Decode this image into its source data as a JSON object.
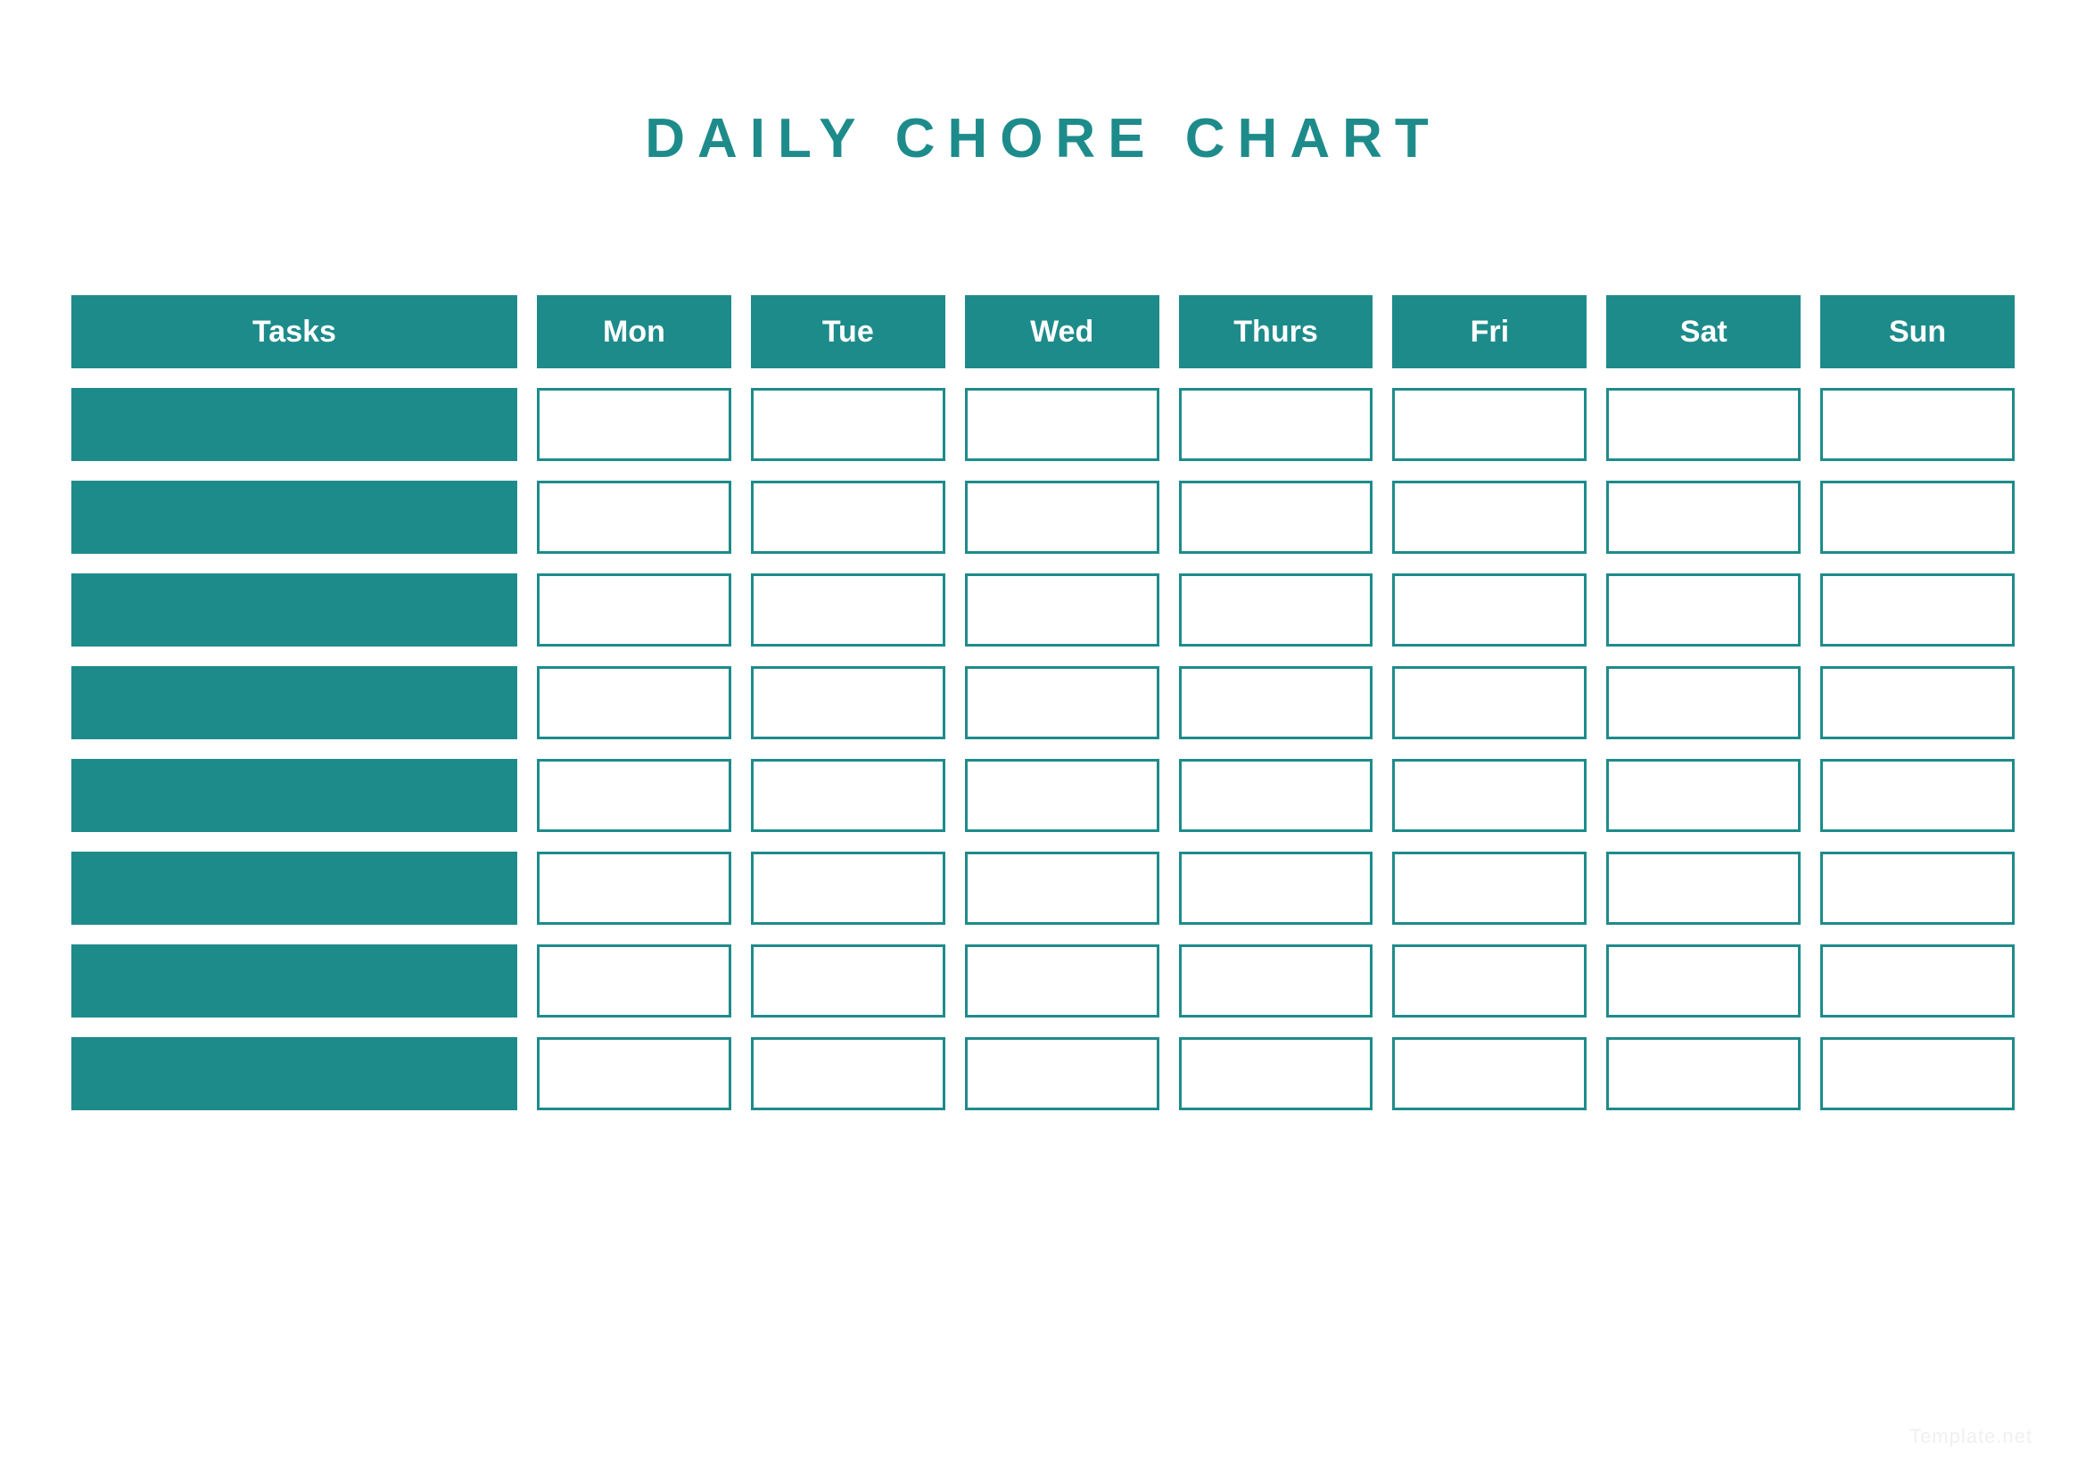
{
  "title": "DAILY CHORE CHART",
  "columns": {
    "tasks_label": "Tasks",
    "days": [
      "Mon",
      "Tue",
      "Wed",
      "Thurs",
      "Fri",
      "Sat",
      "Sun"
    ]
  },
  "rows": [
    {
      "task": "",
      "cells": [
        "",
        "",
        "",
        "",
        "",
        "",
        ""
      ]
    },
    {
      "task": "",
      "cells": [
        "",
        "",
        "",
        "",
        "",
        "",
        ""
      ]
    },
    {
      "task": "",
      "cells": [
        "",
        "",
        "",
        "",
        "",
        "",
        ""
      ]
    },
    {
      "task": "",
      "cells": [
        "",
        "",
        "",
        "",
        "",
        "",
        ""
      ]
    },
    {
      "task": "",
      "cells": [
        "",
        "",
        "",
        "",
        "",
        "",
        ""
      ]
    },
    {
      "task": "",
      "cells": [
        "",
        "",
        "",
        "",
        "",
        "",
        ""
      ]
    },
    {
      "task": "",
      "cells": [
        "",
        "",
        "",
        "",
        "",
        "",
        ""
      ]
    },
    {
      "task": "",
      "cells": [
        "",
        "",
        "",
        "",
        "",
        "",
        ""
      ]
    }
  ],
  "watermark": "Template.net",
  "colors": {
    "teal": "#1e8b8b",
    "white": "#ffffff"
  },
  "chart_data": {
    "type": "table",
    "title": "DAILY CHORE CHART",
    "columns": [
      "Tasks",
      "Mon",
      "Tue",
      "Wed",
      "Thurs",
      "Fri",
      "Sat",
      "Sun"
    ],
    "rows": [
      [
        "",
        "",
        "",
        "",
        "",
        "",
        "",
        ""
      ],
      [
        "",
        "",
        "",
        "",
        "",
        "",
        "",
        ""
      ],
      [
        "",
        "",
        "",
        "",
        "",
        "",
        "",
        ""
      ],
      [
        "",
        "",
        "",
        "",
        "",
        "",
        "",
        ""
      ],
      [
        "",
        "",
        "",
        "",
        "",
        "",
        "",
        ""
      ],
      [
        "",
        "",
        "",
        "",
        "",
        "",
        "",
        ""
      ],
      [
        "",
        "",
        "",
        "",
        "",
        "",
        "",
        ""
      ],
      [
        "",
        "",
        "",
        "",
        "",
        "",
        "",
        ""
      ]
    ]
  }
}
